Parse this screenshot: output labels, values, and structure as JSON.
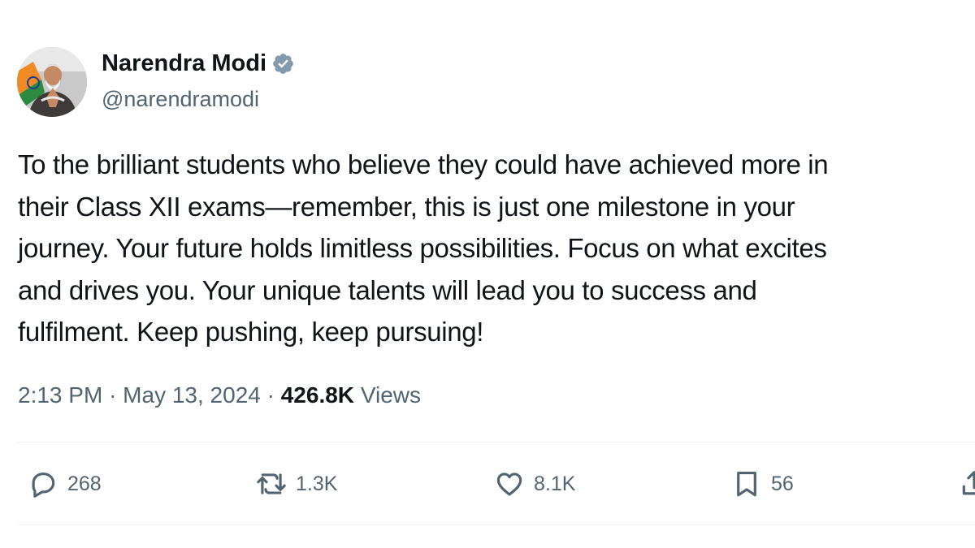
{
  "author": {
    "display_name": "Narendra Modi",
    "handle": "@narendramodi",
    "verified": true,
    "verified_color": "#829aab"
  },
  "tweet": {
    "text_lines": [
      "To the brilliant students who believe they could have achieved more in",
      "their Class XII exams—remember, this is just one milestone in your",
      "journey. Your future holds limitless possibilities. Focus on what excites",
      "and drives you. Your unique talents will lead you to success and",
      "fulfilment. Keep pushing, keep pursuing!"
    ],
    "time": "2:13 PM",
    "separator": "·",
    "date": "May 13, 2024",
    "views_count": "426.8K",
    "views_label": "Views"
  },
  "actions": {
    "replies": "268",
    "reposts": "1.3K",
    "likes": "8.1K",
    "bookmarks": "56"
  },
  "colors": {
    "text_primary": "#0f1419",
    "text_secondary": "#536471",
    "divider": "#eff3f4"
  },
  "icons": {
    "reply": "speech-bubble-icon",
    "repost": "repost-arrows-icon",
    "like": "heart-icon",
    "bookmark": "bookmark-icon",
    "share": "share-icon"
  }
}
